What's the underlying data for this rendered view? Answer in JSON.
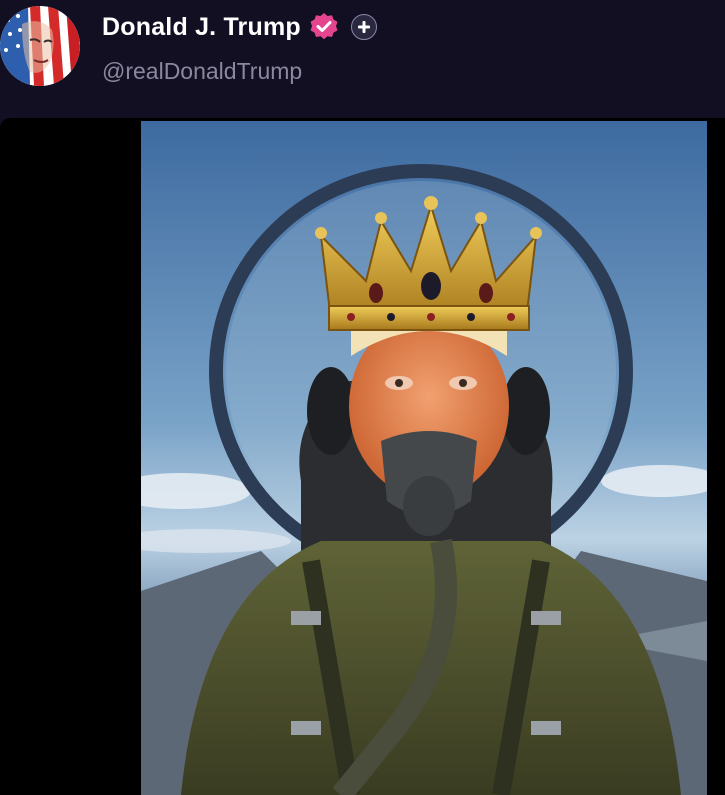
{
  "post": {
    "author": {
      "display_name": "Donald J. Trump",
      "handle": "@realDonaldTrump",
      "verified_color": "#e5448f",
      "avatar_icon": "american-flag-portrait"
    },
    "follow_icon": "plus-icon",
    "media": {
      "type": "video",
      "description_icon": "ai-generated-image-pilot-with-crown"
    }
  },
  "colors": {
    "background": "#120f22",
    "handle_text": "#8a879f",
    "name_text": "#ffffff"
  }
}
